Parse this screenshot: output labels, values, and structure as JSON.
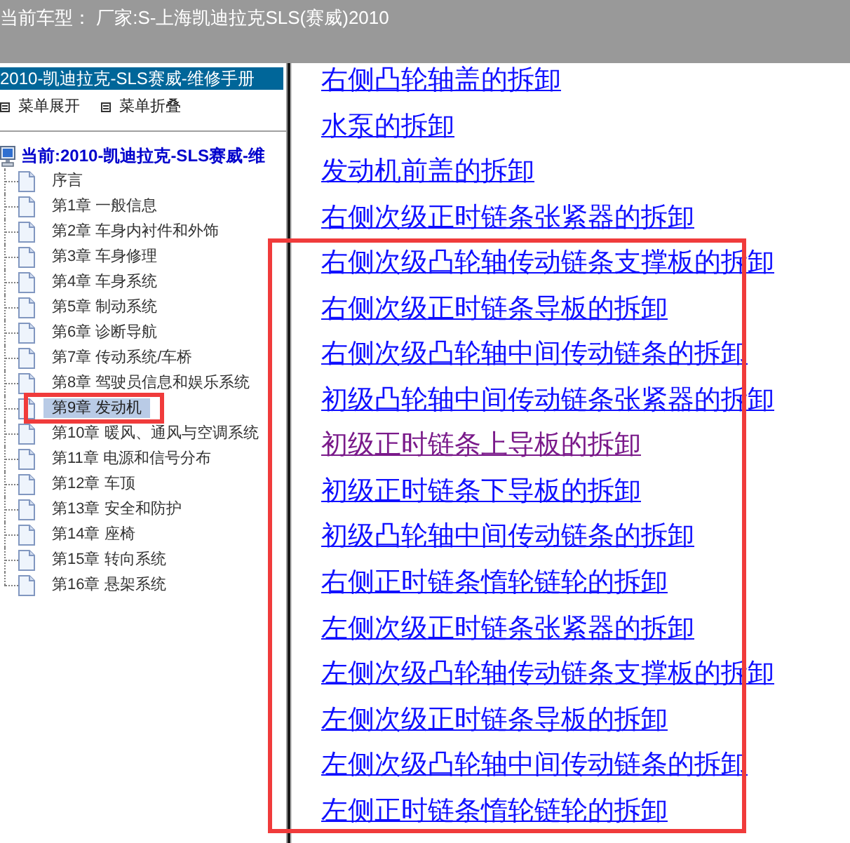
{
  "top_bar": {
    "text": "当前车型： 厂家:S-上海凯迪拉克SLS(赛威)2010"
  },
  "sidebar": {
    "title": "2010-凯迪拉克-SLS赛威-维修手册",
    "menu_actions": [
      {
        "label": "菜单展开"
      },
      {
        "label": "菜单折叠"
      }
    ],
    "tree": {
      "label": "当前:2010-凯迪拉克-SLS赛威-维",
      "children": [
        {
          "label": "序言",
          "selected": false
        },
        {
          "label": "第1章 一般信息",
          "selected": false
        },
        {
          "label": "第2章 车身内衬件和外饰",
          "selected": false
        },
        {
          "label": "第3章 车身修理",
          "selected": false
        },
        {
          "label": "第4章 车身系统",
          "selected": false
        },
        {
          "label": "第5章 制动系统",
          "selected": false
        },
        {
          "label": "第6章 诊断导航",
          "selected": false
        },
        {
          "label": "第7章 传动系统/车桥",
          "selected": false
        },
        {
          "label": "第8章 驾驶员信息和娱乐系统",
          "selected": false
        },
        {
          "label": "第9章 发动机",
          "selected": true
        },
        {
          "label": "第10章 暖风、通风与空调系统",
          "selected": false
        },
        {
          "label": "第11章 电源和信号分布",
          "selected": false
        },
        {
          "label": "第12章 车顶",
          "selected": false
        },
        {
          "label": "第13章 安全和防护",
          "selected": false
        },
        {
          "label": "第14章 座椅",
          "selected": false
        },
        {
          "label": "第15章 转向系统",
          "selected": false
        },
        {
          "label": "第16章 悬架系统",
          "selected": false
        }
      ]
    }
  },
  "content": {
    "links": [
      {
        "text": "右侧凸轮轴盖的拆卸",
        "visited": false
      },
      {
        "text": "水泵的拆卸",
        "visited": false
      },
      {
        "text": "发动机前盖的拆卸",
        "visited": false
      },
      {
        "text": "右侧次级正时链条张紧器的拆卸",
        "visited": false
      },
      {
        "text": "右侧次级凸轮轴传动链条支撑板的拆卸",
        "visited": false
      },
      {
        "text": "右侧次级正时链条导板的拆卸",
        "visited": false
      },
      {
        "text": "右侧次级凸轮轴中间传动链条的拆卸",
        "visited": false
      },
      {
        "text": "初级凸轮轴中间传动链条张紧器的拆卸",
        "visited": false
      },
      {
        "text": "初级正时链条上导板的拆卸",
        "visited": true
      },
      {
        "text": "初级正时链条下导板的拆卸",
        "visited": false
      },
      {
        "text": "初级凸轮轴中间传动链条的拆卸",
        "visited": false
      },
      {
        "text": "右侧正时链条惰轮链轮的拆卸",
        "visited": false
      },
      {
        "text": "左侧次级正时链条张紧器的拆卸",
        "visited": false
      },
      {
        "text": "左侧次级凸轮轴传动链条支撑板的拆卸",
        "visited": false
      },
      {
        "text": "左侧次级正时链条导板的拆卸",
        "visited": false
      },
      {
        "text": "左侧次级凸轮轴中间传动链条的拆卸",
        "visited": false
      },
      {
        "text": "左侧正时链条惰轮链轮的拆卸",
        "visited": false
      }
    ]
  },
  "annotations": [
    {
      "kind": "rectangle"
    },
    {
      "kind": "rectangle"
    }
  ]
}
